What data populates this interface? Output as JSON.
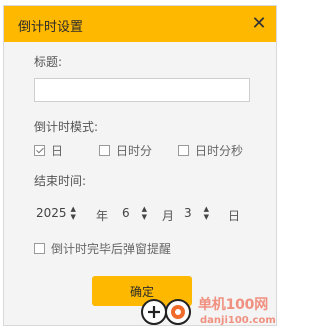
{
  "dialog": {
    "title": "倒计时设置",
    "close_icon": "close-icon"
  },
  "title_field": {
    "label": "标题:",
    "value": ""
  },
  "mode": {
    "label": "倒计时模式:",
    "options": [
      {
        "label": "日",
        "checked": true
      },
      {
        "label": "日时分",
        "checked": false
      },
      {
        "label": "日时分秒",
        "checked": false
      }
    ]
  },
  "end_time": {
    "label": "结束时间:",
    "year": "2025",
    "year_unit": "年",
    "month": "6",
    "month_unit": "月",
    "day": "3",
    "day_unit": "日"
  },
  "popup_option": {
    "label": "倒计时完毕后弹窗提醒",
    "checked": false
  },
  "ok_button": "确定",
  "watermark": {
    "text": "单机100网",
    "sub": "danji100.com"
  },
  "colors": {
    "accent": "#ffb800",
    "dialog_bg": "#f4f4f4",
    "watermark": "#f09080"
  }
}
